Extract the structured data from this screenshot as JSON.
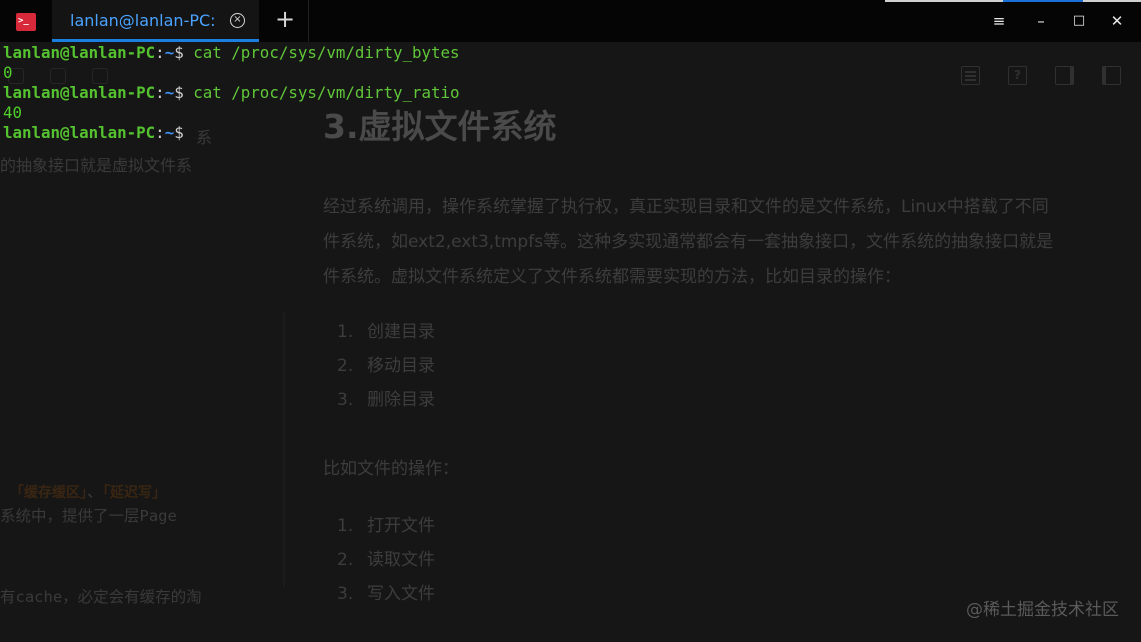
{
  "window": {
    "tab_title": "lanlan@lanlan-PC:",
    "tab_close_glyph": "×",
    "new_tab_glyph": "+",
    "menu_glyph": "≡",
    "minimize_glyph": "–",
    "maximize_glyph": "□",
    "close_glyph": "✕",
    "app_icon_glyph": ">_"
  },
  "terminal": {
    "prompt": {
      "user": "lanlan@lanlan-PC",
      "colon": ":",
      "path": "~",
      "dollar": "$ "
    },
    "lines": [
      {
        "type": "cmd",
        "command": "cat /proc/sys/vm/dirty_bytes"
      },
      {
        "type": "out",
        "text": "0"
      },
      {
        "type": "cmd",
        "command": "cat /proc/sys/vm/dirty_ratio"
      },
      {
        "type": "out",
        "text": "40"
      },
      {
        "type": "cmd",
        "command": ""
      }
    ]
  },
  "background_doc": {
    "toolbar_icons": [
      "outline-icon",
      "help-icon",
      "sidebar-icon",
      "copy-icon"
    ],
    "left_fragments": {
      "line1": "系",
      "line2": "的抽象接口就是虚拟文件系",
      "highlight1": "「缓存缓区」",
      "sep": "、",
      "highlight2": "「延迟写」",
      "line4": "系统中，提供了一层Page",
      "line5": "有cache，必定会有缓存的淘"
    },
    "title": "3.虚拟文件系统",
    "paragraph": [
      "经过系统调用，操作系统掌握了执行权，真正实现目录和文件的是文件系统，Linux中搭载了不同",
      "件系统，如ext2,ext3,tmpfs等。这种多实现通常都会有一套抽象接口，文件系统的抽象接口就是",
      "件系统。虚拟文件系统定义了文件系统都需要实现的方法，比如目录的操作："
    ],
    "dir_ops": [
      "创建目录",
      "移动目录",
      "删除目录"
    ],
    "file_ops_label": "比如文件的操作：",
    "file_ops": [
      "打开文件",
      "读取文件",
      "写入文件"
    ],
    "watermark": "@稀土掘金技术社区"
  }
}
